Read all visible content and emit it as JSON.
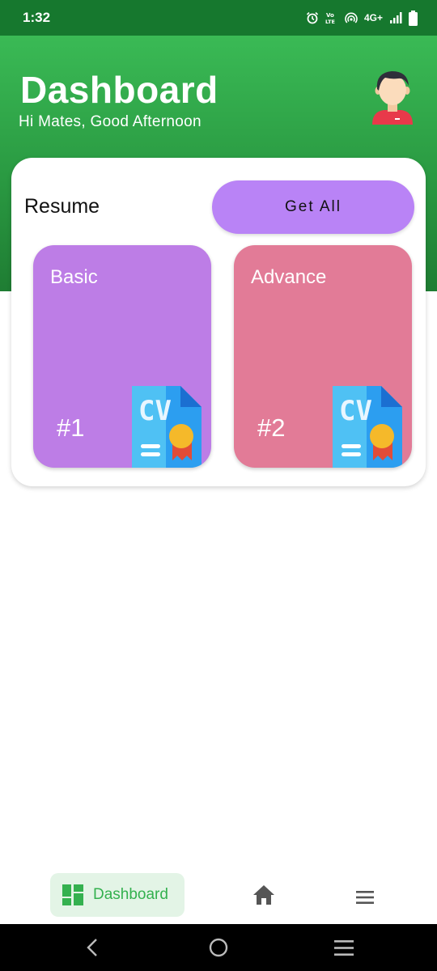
{
  "status_bar": {
    "time": "1:32",
    "network": "4G+",
    "icons": [
      "alarm-icon",
      "volte-icon",
      "hotspot-icon",
      "signal-icon",
      "battery-icon"
    ]
  },
  "header": {
    "title": "Dashboard",
    "subtitle": "Hi Mates, Good Afternoon",
    "avatar_icon": "user-avatar-icon"
  },
  "resume_card": {
    "label": "Resume",
    "get_all_label": "Get All",
    "tiles": [
      {
        "name": "Basic",
        "number": "#1",
        "icon": "cv-document-icon",
        "color": "#bd7de6"
      },
      {
        "name": "Advance",
        "number": "#2",
        "icon": "cv-document-icon",
        "color": "#e27b97"
      }
    ]
  },
  "bottom_nav": {
    "dashboard_label": "Dashboard",
    "items": [
      "dashboard-icon",
      "home-icon",
      "menu-icon"
    ]
  },
  "colors": {
    "header_green": "#2a9a42",
    "status_green": "#16782e",
    "accent_purple": "#b983f6",
    "nav_active_bg": "#e3f4e6",
    "nav_active_text": "#34b14f"
  }
}
